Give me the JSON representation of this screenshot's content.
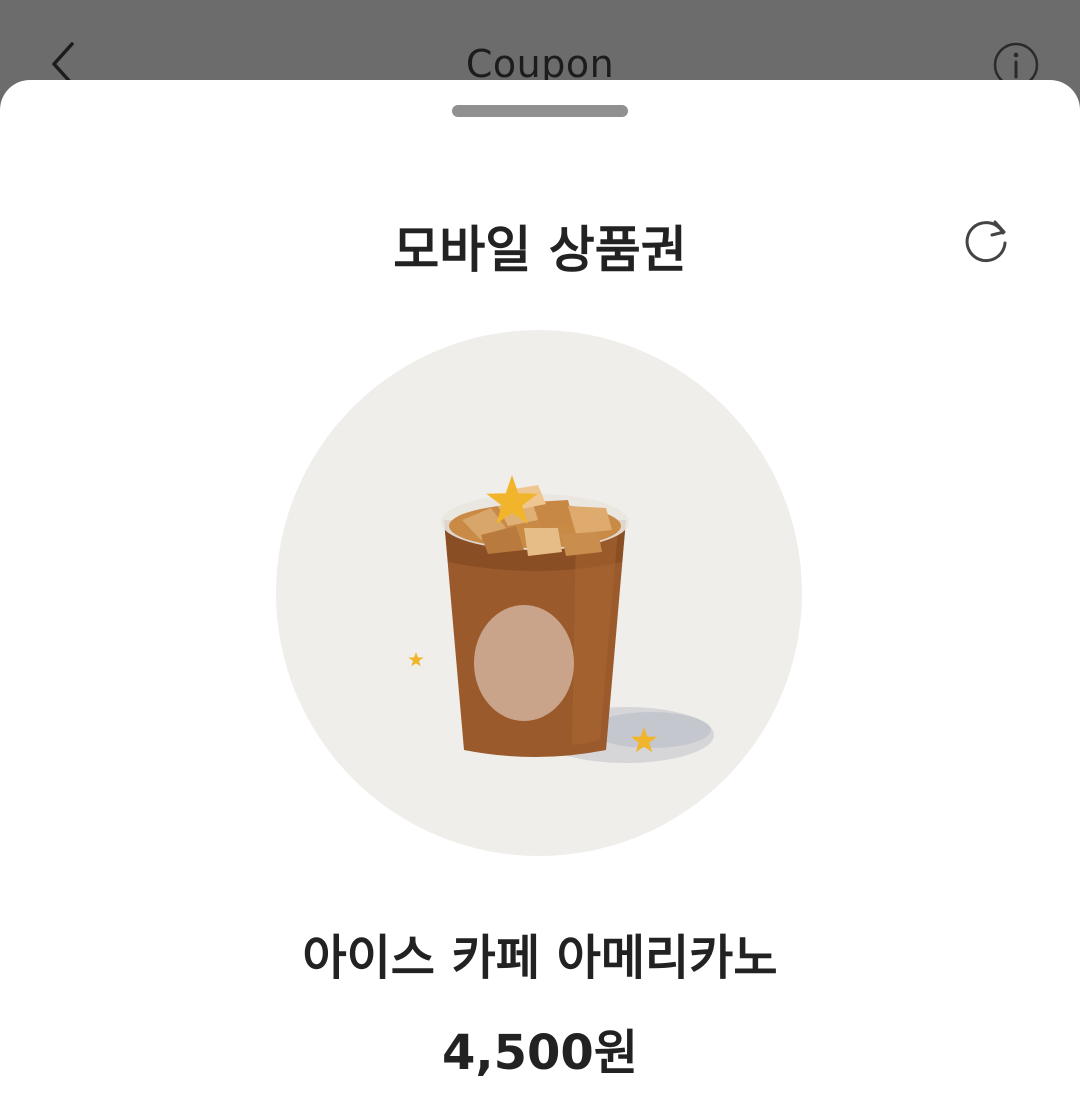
{
  "navbar": {
    "title": "Coupon",
    "back_icon": "chevron-left-icon",
    "info_icon": "info-circle-icon"
  },
  "sheet": {
    "title": "모바일 상품권",
    "refresh_icon": "refresh-icon",
    "product": {
      "name": "아이스 카페 아메리카노",
      "price": "4,500원",
      "image": "iced-coffee-cup-with-stars"
    }
  },
  "colors": {
    "overlay": "#6c6c6c",
    "sheet": "#ffffff",
    "text": "#222222",
    "circle_bg": "#f0eeea",
    "coffee": "#9a5a2c",
    "star": "#f1b52b"
  }
}
